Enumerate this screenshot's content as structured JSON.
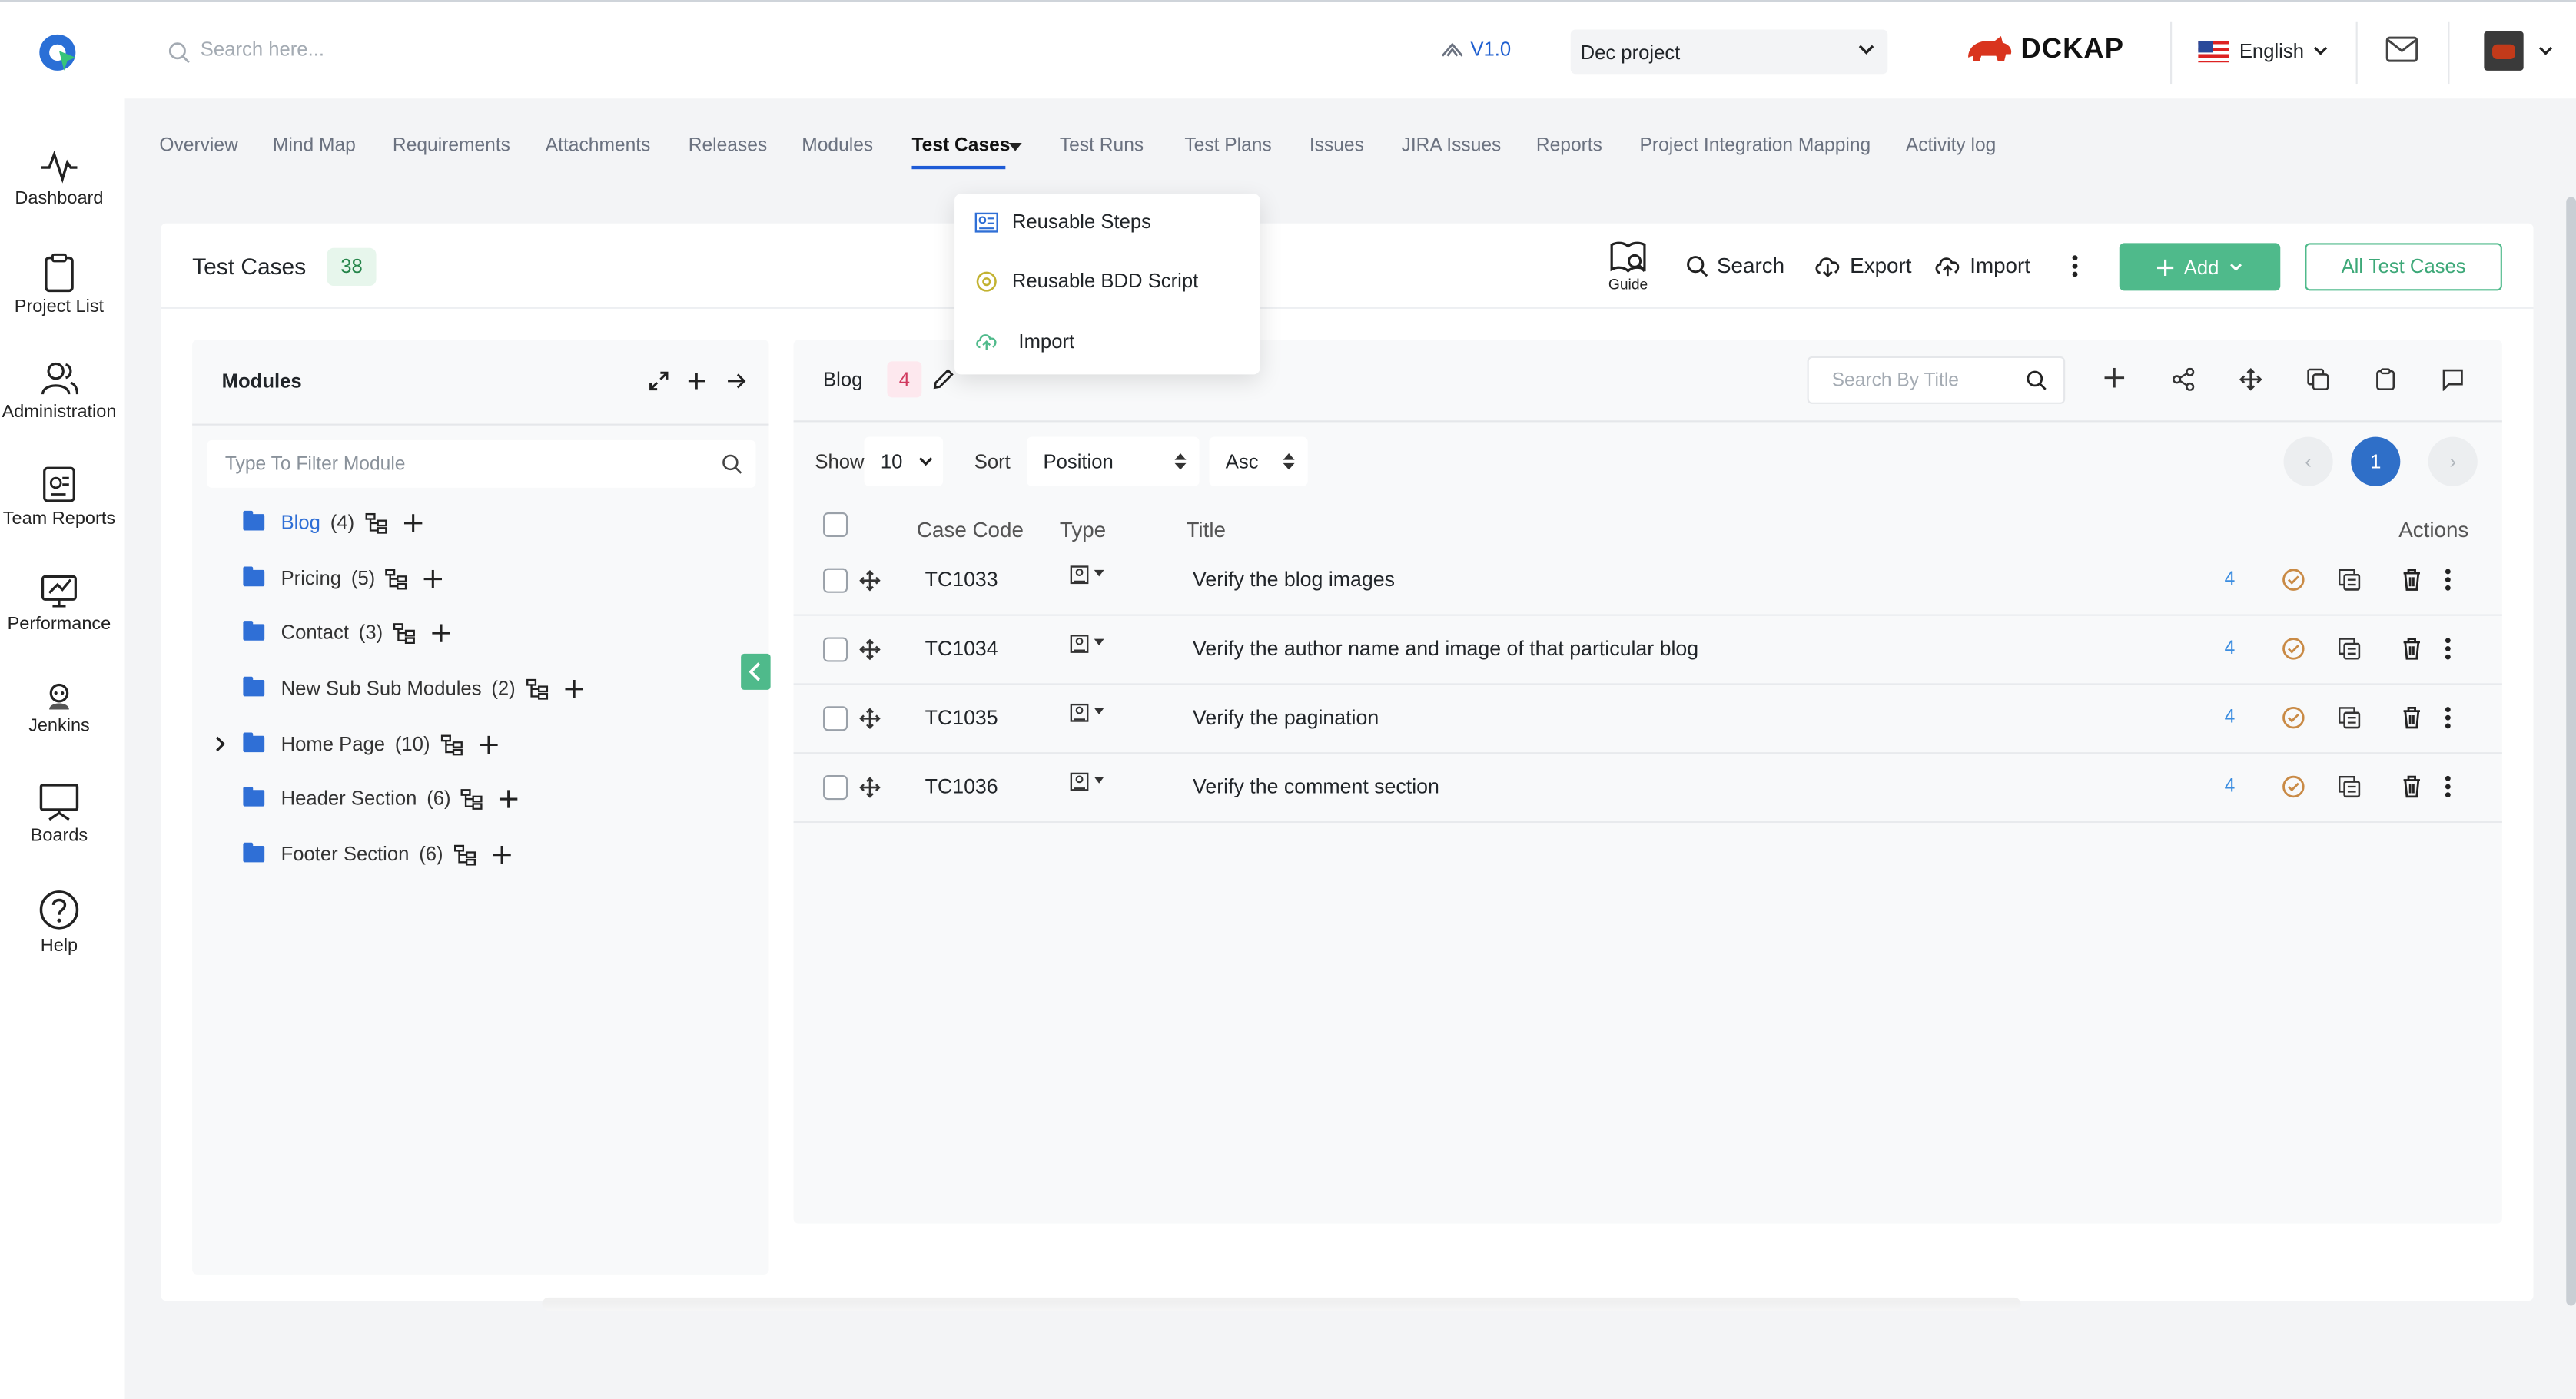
{
  "header": {
    "search_placeholder": "Search here...",
    "version": "V1.0",
    "project": "Dec project",
    "brand": "DCKAP",
    "language": "English"
  },
  "sidebar": {
    "items": [
      {
        "label": "Dashboard",
        "icon": "pulse-icon"
      },
      {
        "label": "Project List",
        "icon": "clipboard-icon"
      },
      {
        "label": "Administration",
        "icon": "users-icon"
      },
      {
        "label": "Team Reports",
        "icon": "team-report-icon"
      },
      {
        "label": "Performance",
        "icon": "performance-icon"
      },
      {
        "label": "Jenkins",
        "icon": "jenkins-icon"
      },
      {
        "label": "Boards",
        "icon": "board-icon"
      },
      {
        "label": "Help",
        "icon": "help-icon"
      }
    ]
  },
  "tabs": [
    "Overview",
    "Mind Map",
    "Requirements",
    "Attachments",
    "Releases",
    "Modules",
    "Test Cases",
    "Test Runs",
    "Test Plans",
    "Issues",
    "JIRA Issues",
    "Reports",
    "Project Integration Mapping",
    "Activity log"
  ],
  "active_tab": "Test Cases",
  "testcases_dropdown": {
    "items": [
      {
        "label": "Reusable Steps",
        "icon": "steps-icon"
      },
      {
        "label": "Reusable BDD Script",
        "icon": "bdd-icon"
      },
      {
        "label": "Import",
        "icon": "cloud-upload-icon"
      }
    ]
  },
  "page": {
    "title": "Test Cases",
    "count": "38",
    "guide_label": "Guide",
    "search_label": "Search",
    "export_label": "Export",
    "import_label": "Import",
    "add_label": "Add",
    "all_label": "All Test Cases"
  },
  "modules": {
    "title": "Modules",
    "filter_placeholder": "Type To Filter Module",
    "items": [
      {
        "name": "Blog",
        "count": "(4)"
      },
      {
        "name": "Pricing",
        "count": "(5)"
      },
      {
        "name": "Contact",
        "count": "(3)"
      },
      {
        "name": "New Sub Sub Modules",
        "count": "(2)"
      },
      {
        "name": "Home Page",
        "count": "(10)"
      },
      {
        "name": "Header Section",
        "count": "(6)"
      },
      {
        "name": "Footer Section",
        "count": "(6)"
      }
    ]
  },
  "list": {
    "module": "Blog",
    "module_count": "4",
    "search_placeholder": "Search By Title",
    "show_label": "Show",
    "show_value": "10",
    "sort_label": "Sort",
    "sort_value": "Position",
    "order_value": "Asc",
    "page": "1",
    "columns": {
      "code": "Case Code",
      "type": "Type",
      "title": "Title",
      "actions": "Actions"
    },
    "rows": [
      {
        "code": "TC1033",
        "title": "Verify the blog images",
        "steps": "4"
      },
      {
        "code": "TC1034",
        "title": "Verify the author name and image of that particular blog",
        "steps": "4"
      },
      {
        "code": "TC1035",
        "title": "Verify the pagination",
        "steps": "4"
      },
      {
        "code": "TC1036",
        "title": "Verify the comment section",
        "steps": "4"
      }
    ]
  },
  "colors": {
    "accent": "#4fba8b",
    "primary": "#1e5bd6",
    "blog_badge": "#d0395e"
  }
}
